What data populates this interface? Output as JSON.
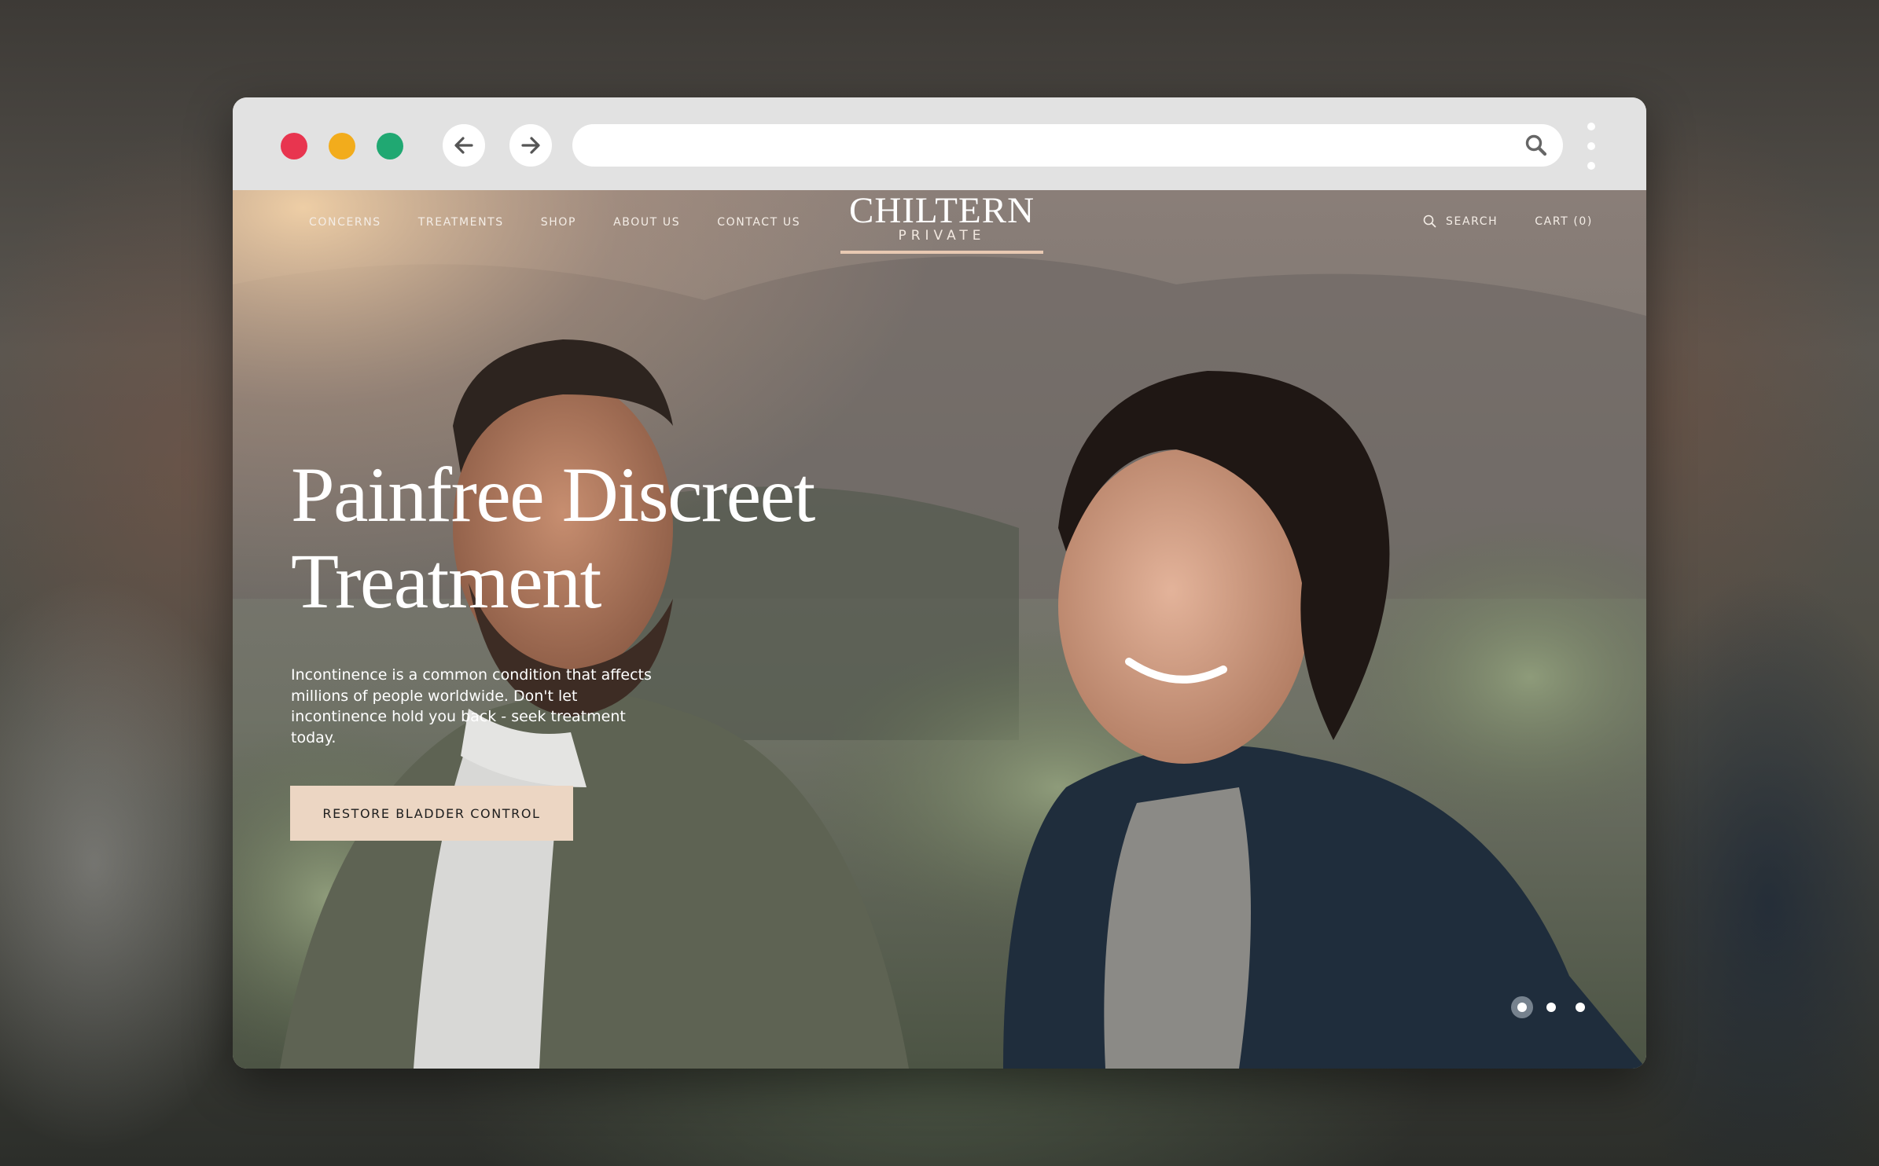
{
  "browser": {
    "url_value": "",
    "window_controls": [
      "close",
      "minimize",
      "maximize"
    ],
    "back_icon": "arrow-left-icon",
    "forward_icon": "arrow-right-icon",
    "search_icon": "search-icon",
    "menu_icon": "kebab-menu-icon"
  },
  "site": {
    "nav": [
      {
        "label": "CONCERNS"
      },
      {
        "label": "TREATMENTS"
      },
      {
        "label": "SHOP"
      },
      {
        "label": "ABOUT US"
      },
      {
        "label": "CONTACT US"
      }
    ],
    "logo": {
      "main": "CHILTERN",
      "sub": "PRIVATE",
      "underline_color": "#e8c9b2"
    },
    "search_label": "SEARCH",
    "cart_label": "CART (0)"
  },
  "hero": {
    "title_line1": "Painfree Discreet",
    "title_line2": "Treatment",
    "body": "Incontinence is a common condition that affects millions of people worldwide. Don't let incontinence hold you back - seek treatment today.",
    "cta_label": "RESTORE BLADDER CONTROL",
    "cta_color": "#ecd6c3",
    "carousel": {
      "slides": 3,
      "active": 1
    }
  },
  "colors": {
    "close": "#e8354f",
    "minimize": "#f2ac1c",
    "maximize": "#20a872",
    "chrome": "#e2e2e2"
  }
}
